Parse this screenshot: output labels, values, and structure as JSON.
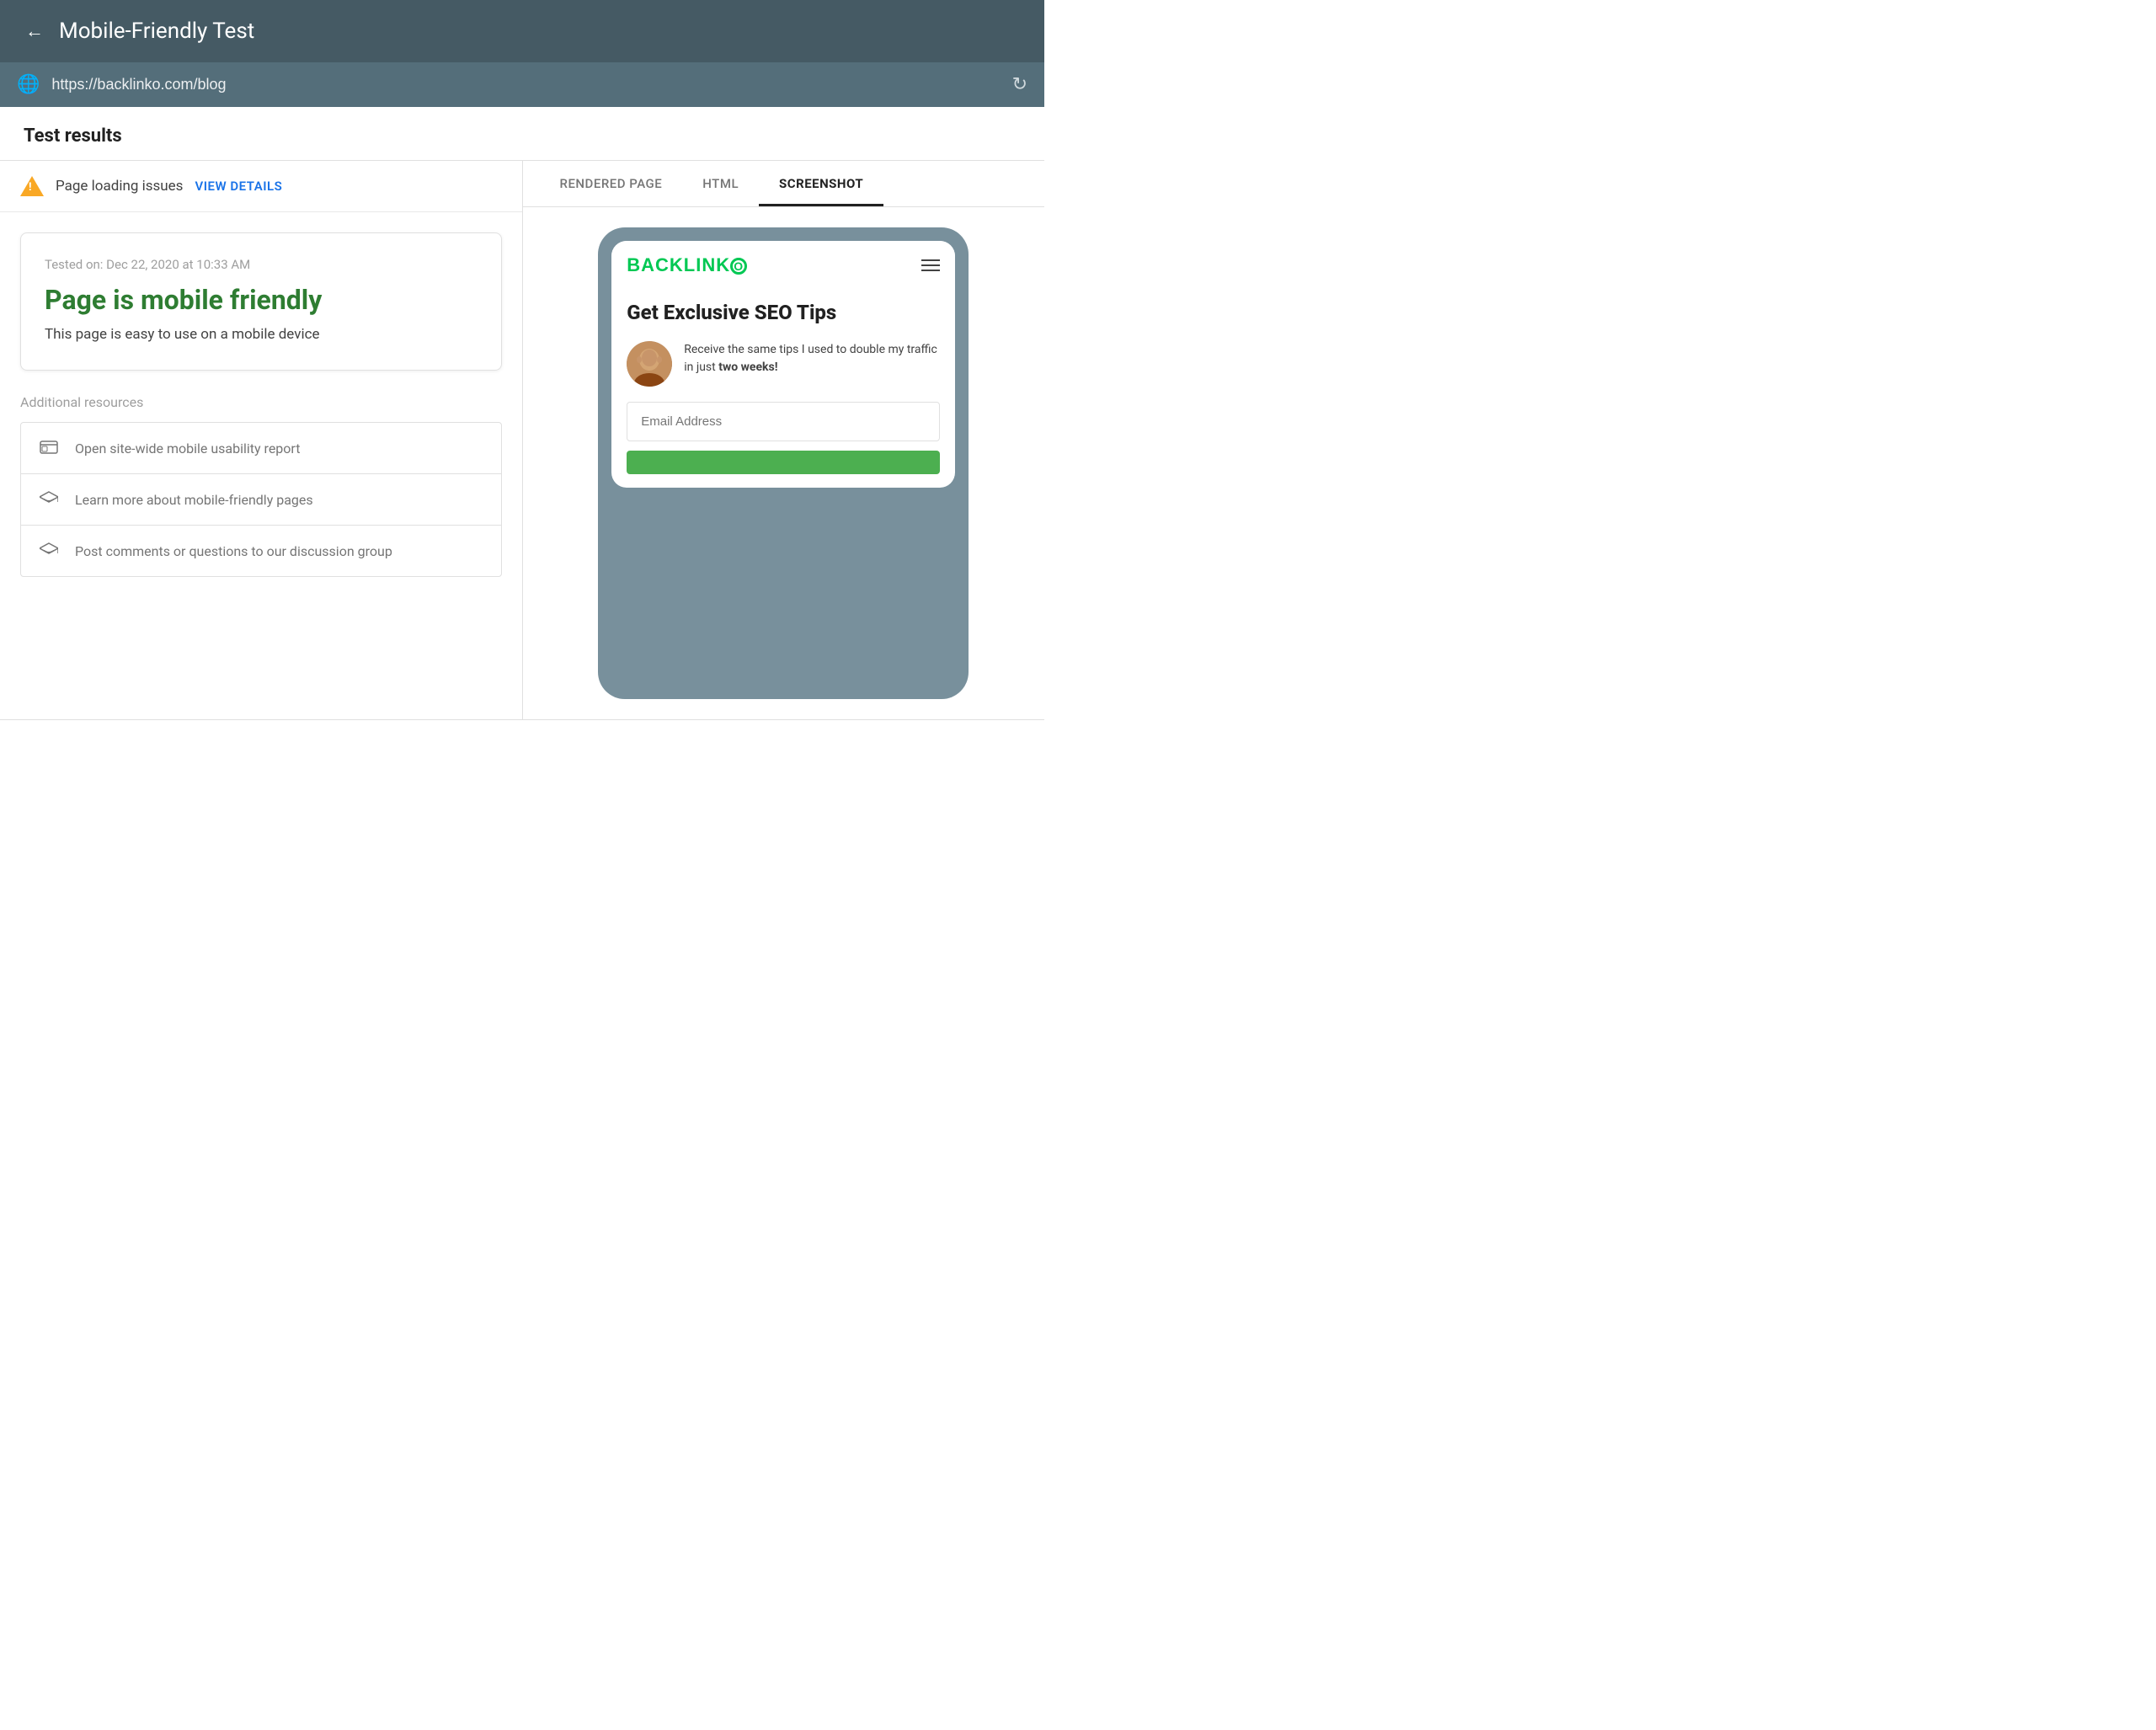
{
  "header": {
    "title": "Mobile-Friendly Test",
    "back_label": "←"
  },
  "url_bar": {
    "url": "https://backlinko.com/blog",
    "globe_icon": "🌐",
    "refresh_icon": "↻"
  },
  "results": {
    "heading": "Test results"
  },
  "issues": {
    "text": "Page loading issues",
    "view_details": "VIEW DETAILS"
  },
  "tabs": {
    "rendered_page": "Rendered page",
    "html": "HTML",
    "screenshot": "SCREENSHOT"
  },
  "result_card": {
    "tested_on": "Tested on: Dec 22, 2020 at 10:33 AM",
    "title": "Page is mobile friendly",
    "description": "This page is easy to use on a mobile device"
  },
  "additional_resources": {
    "title": "Additional resources",
    "items": [
      {
        "icon": "☰",
        "text": "Open site-wide mobile usability report"
      },
      {
        "icon": "🎓",
        "text": "Learn more about mobile-friendly pages"
      },
      {
        "icon": "🎓",
        "text": "Post comments or questions to our discussion group"
      }
    ]
  },
  "phone": {
    "logo": "BACKLINK",
    "logo_o": "O",
    "headline": "Get Exclusive SEO Tips",
    "author_text_1": "Receive the same tips I used to double my traffic in just ",
    "author_text_bold": "two weeks!",
    "email_placeholder": "Email Address",
    "cta_button": ""
  }
}
